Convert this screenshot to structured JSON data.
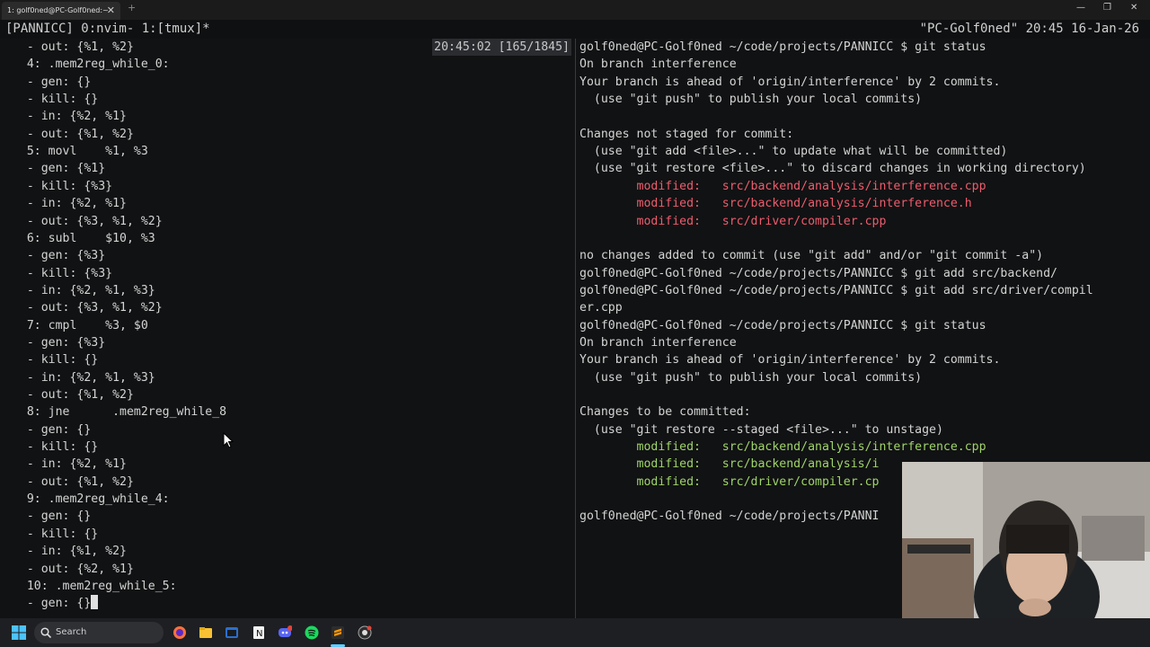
{
  "window": {
    "tab_title": "1: golf0ned@PC-Golf0ned:~",
    "tab_close": "✕",
    "new_tab": "+",
    "controls": [
      "—",
      "❐",
      "✕"
    ]
  },
  "tmux": {
    "left": "[PANNICC] 0:nvim- 1:[tmux]*",
    "right": "\"PC-Golf0ned\" 20:45 16-Jan-26"
  },
  "left_pane": {
    "position_indicator": "20:45:02 [165/1845]",
    "lines": [
      "   - out: {%1, %2}",
      "   4: .mem2reg_while_0:",
      "   - gen: {}",
      "   - kill: {}",
      "   - in: {%2, %1}",
      "   - out: {%1, %2}",
      "   5: movl    %1, %3",
      "   - gen: {%1}",
      "   - kill: {%3}",
      "   - in: {%2, %1}",
      "   - out: {%3, %1, %2}",
      "   6: subl    $10, %3",
      "   - gen: {%3}",
      "   - kill: {%3}",
      "   - in: {%2, %1, %3}",
      "   - out: {%3, %1, %2}",
      "   7: cmpl    %3, $0",
      "   - gen: {%3}",
      "   - kill: {}",
      "   - in: {%2, %1, %3}",
      "   - out: {%1, %2}",
      "   8: jne      .mem2reg_while_8",
      "   - gen: {}",
      "   - kill: {}",
      "   - in: {%2, %1}",
      "   - out: {%1, %2}",
      "   9: .mem2reg_while_4:",
      "   - gen: {}",
      "   - kill: {}",
      "   - in: {%1, %2}",
      "   - out: {%2, %1}",
      "   10: .mem2reg_while_5:",
      "   - gen: {}"
    ]
  },
  "right_pane": {
    "lines": [
      {
        "text": "golf0ned@PC-Golf0ned ~/code/projects/PANNICC $ git status",
        "color": "default"
      },
      {
        "text": "On branch interference",
        "color": "default"
      },
      {
        "text": "Your branch is ahead of 'origin/interference' by 2 commits.",
        "color": "default"
      },
      {
        "text": "  (use \"git push\" to publish your local commits)",
        "color": "default"
      },
      {
        "text": "",
        "color": "default"
      },
      {
        "text": "Changes not staged for commit:",
        "color": "default"
      },
      {
        "text": "  (use \"git add <file>...\" to update what will be committed)",
        "color": "default"
      },
      {
        "text": "  (use \"git restore <file>...\" to discard changes in working directory)",
        "color": "default"
      },
      {
        "text": "        modified:   src/backend/analysis/interference.cpp",
        "color": "red"
      },
      {
        "text": "        modified:   src/backend/analysis/interference.h",
        "color": "red"
      },
      {
        "text": "        modified:   src/driver/compiler.cpp",
        "color": "red"
      },
      {
        "text": "",
        "color": "default"
      },
      {
        "text": "no changes added to commit (use \"git add\" and/or \"git commit -a\")",
        "color": "default"
      },
      {
        "text": "golf0ned@PC-Golf0ned ~/code/projects/PANNICC $ git add src/backend/",
        "color": "default"
      },
      {
        "text": "golf0ned@PC-Golf0ned ~/code/projects/PANNICC $ git add src/driver/compil",
        "color": "default"
      },
      {
        "text": "er.cpp",
        "color": "default"
      },
      {
        "text": "golf0ned@PC-Golf0ned ~/code/projects/PANNICC $ git status",
        "color": "default"
      },
      {
        "text": "On branch interference",
        "color": "default"
      },
      {
        "text": "Your branch is ahead of 'origin/interference' by 2 commits.",
        "color": "default"
      },
      {
        "text": "  (use \"git push\" to publish your local commits)",
        "color": "default"
      },
      {
        "text": "",
        "color": "default"
      },
      {
        "text": "Changes to be committed:",
        "color": "default"
      },
      {
        "text": "  (use \"git restore --staged <file>...\" to unstage)",
        "color": "default"
      },
      {
        "text": "        modified:   src/backend/analysis/interference.cpp",
        "color": "green"
      },
      {
        "text": "        modified:   src/backend/analysis/i",
        "color": "green"
      },
      {
        "text": "        modified:   src/driver/compiler.cp",
        "color": "green"
      },
      {
        "text": "",
        "color": "default"
      },
      {
        "text": "golf0ned@PC-Golf0ned ~/code/projects/PANNI",
        "color": "default"
      }
    ]
  },
  "taskbar": {
    "search_placeholder": "Search",
    "icons": [
      "windows-start-icon",
      "search-icon",
      "firefox-icon",
      "file-explorer-icon",
      "windows-terminal-icon",
      "notion-icon",
      "discord-icon",
      "spotify-icon",
      "sublime-text-icon",
      "github-desktop-icon"
    ]
  },
  "colors": {
    "background": "#111213",
    "text": "#d4d4d4",
    "unstaged": "#ee5c6e",
    "staged": "#9fd46a"
  }
}
